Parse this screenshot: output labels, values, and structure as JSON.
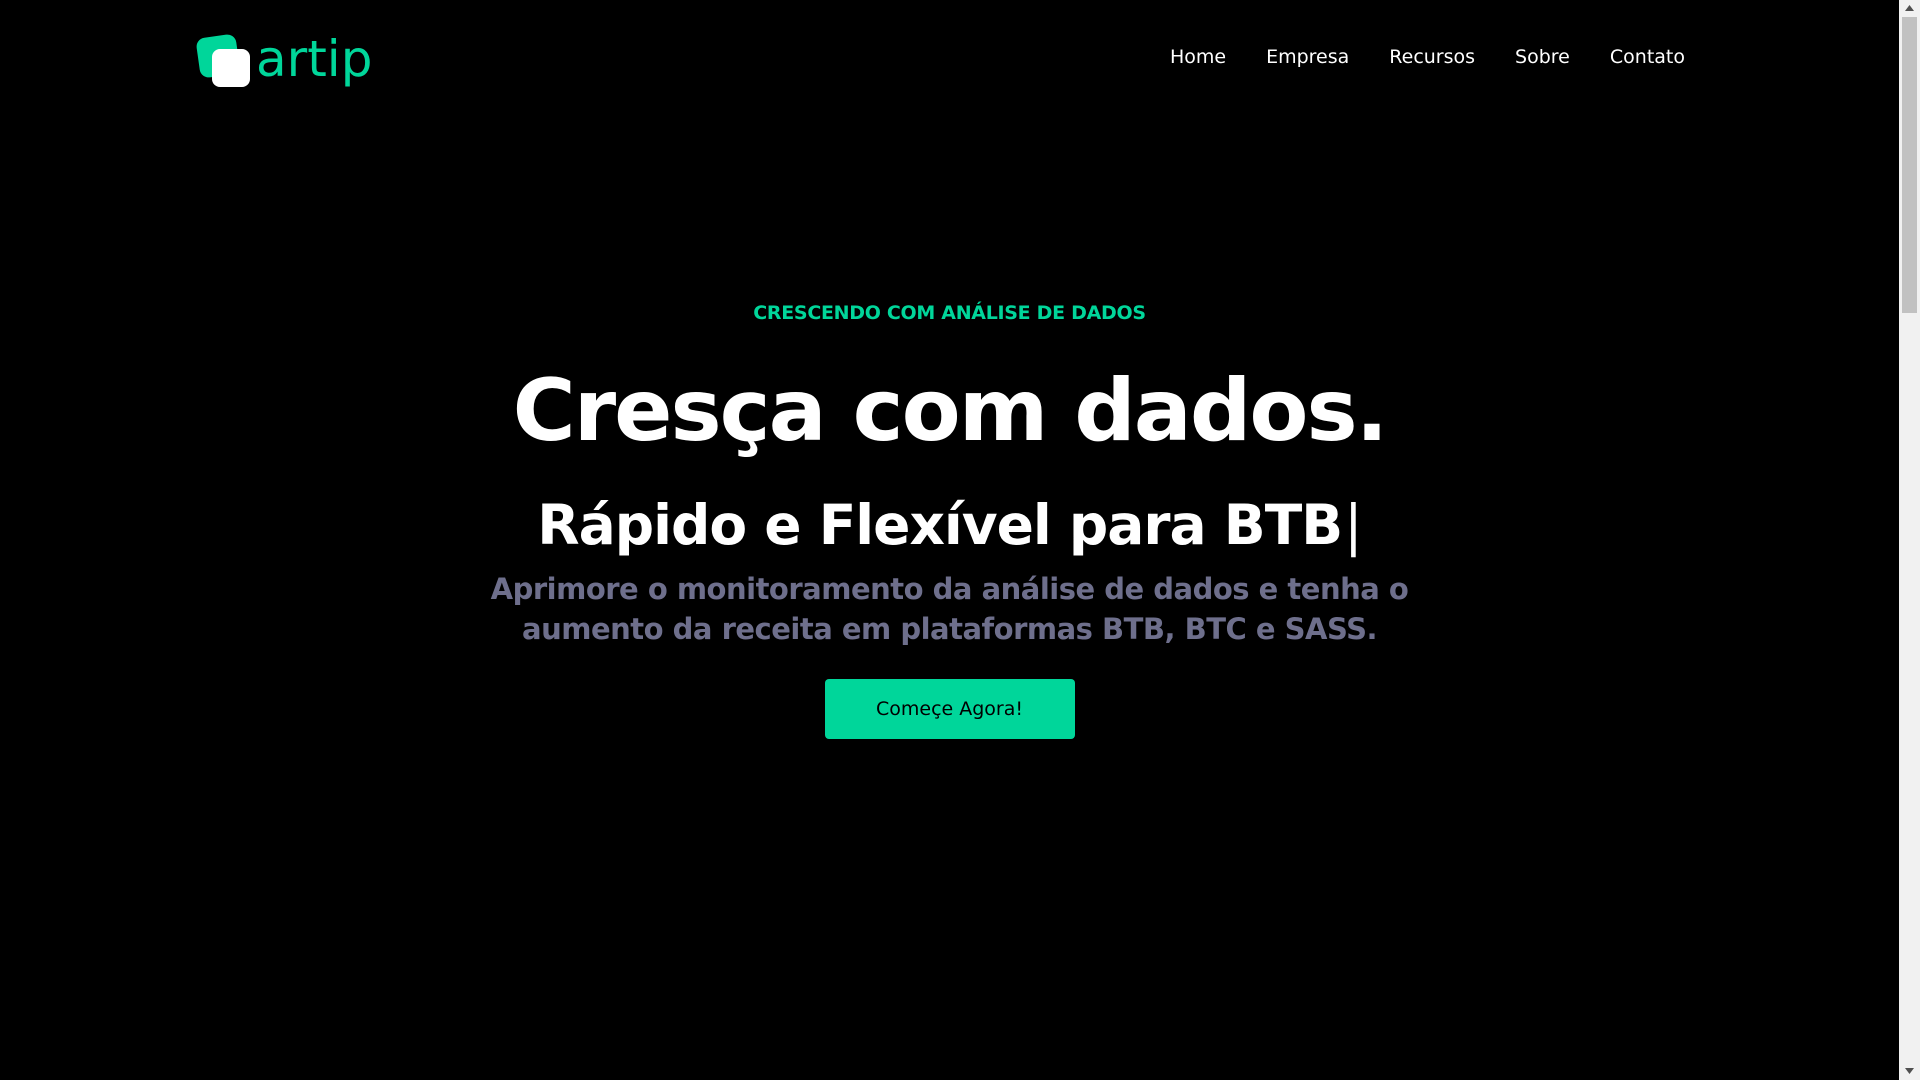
{
  "brand": {
    "name": "artip",
    "logo_icon": "stacked-cards-logo",
    "accent_color": "#00d69a"
  },
  "nav": {
    "items": [
      {
        "label": "Home"
      },
      {
        "label": "Empresa"
      },
      {
        "label": "Recursos"
      },
      {
        "label": "Sobre"
      },
      {
        "label": "Contato"
      }
    ]
  },
  "hero": {
    "eyebrow": "CRESCENDO COM ANÁLISE DE DADOS",
    "headline": "Cresça com dados.",
    "typed_text": "Rápido e Flexível para BTB",
    "typed_cursor": "|",
    "subtitle": "Aprimore o monitoramento da análise de dados e tenha o aumento da receita em plataformas BTB, BTC e SASS.",
    "cta_label": "Começe Agora!"
  },
  "colors": {
    "background": "#000000",
    "text": "#ffffff",
    "muted": "#6e6f8c"
  }
}
